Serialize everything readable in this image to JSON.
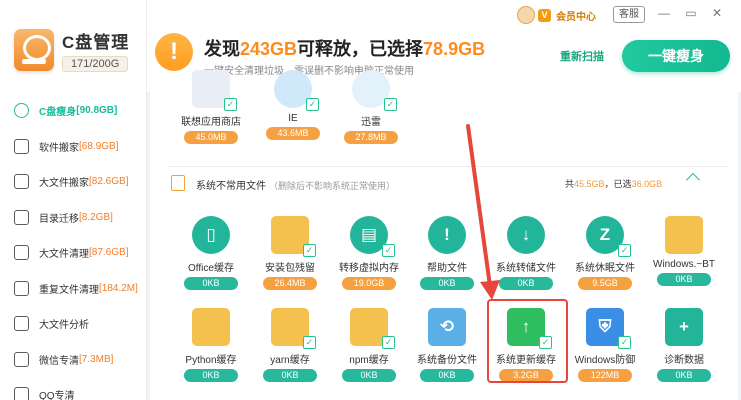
{
  "app": {
    "title": "C盘管理",
    "capacity": "171/200G"
  },
  "sidebar": {
    "items": [
      {
        "label": "C盘瘦身",
        "num": "[90.8GB]",
        "icon": "disk-slim-icon",
        "active": true
      },
      {
        "label": "软件搬家",
        "num": "[68.9GB]",
        "icon": "software-move-icon"
      },
      {
        "label": "大文件搬家",
        "num": "[82.6GB]",
        "icon": "bigfile-move-icon"
      },
      {
        "label": "目录迁移",
        "num": "[8.2GB]",
        "icon": "folder-migrate-icon"
      },
      {
        "label": "大文件清理",
        "num": "[87.6GB]",
        "icon": "bigfile-clean-icon"
      },
      {
        "label": "重复文件清理",
        "num": "[184.2M]",
        "icon": "duplicate-file-icon"
      },
      {
        "label": "大文件分析",
        "num": "",
        "icon": "file-analysis-icon"
      },
      {
        "label": "微信专清",
        "num": "[7.3MB]",
        "icon": "wechat-icon"
      },
      {
        "label": "QQ专清",
        "num": "",
        "icon": "qq-icon"
      }
    ]
  },
  "header": {
    "headline_pre": "发现",
    "headline_total": "243GB",
    "headline_mid": "可释放，已选择",
    "headline_selected": "78.9GB",
    "subline": "一键安全清理垃圾，零误删不影响电脑正常使用",
    "vip_label": "会员中心",
    "service_label": "客服",
    "minimize": "—",
    "maximize": "▭",
    "close": "✕",
    "rescan_label": "重新扫描",
    "slim_button_label": "一键瘦身"
  },
  "top_items": [
    {
      "name": "联想应用商店",
      "size": "45.0MB",
      "icon": "lenovo-store-icon"
    },
    {
      "name": "IE",
      "size": "43.6MB",
      "icon": "ie-icon"
    },
    {
      "name": "迅雷",
      "size": "27.8MB",
      "icon": "xunlei-icon"
    }
  ],
  "section": {
    "title": "系统不常用文件",
    "subtitle": "（删除后不影响系统正常使用）",
    "total_label": "共",
    "total": "45.5GB",
    "selected_label": "，已选",
    "selected": "36.0GB"
  },
  "row1": [
    {
      "name": "Office缓存",
      "size": "0KB",
      "icon": "office-icon"
    },
    {
      "name": "安装包残留",
      "size": "26.4MB",
      "icon": "package-icon"
    },
    {
      "name": "转移虚拟内存",
      "size": "19.0GB",
      "icon": "virtual-memory-icon"
    },
    {
      "name": "帮助文件",
      "size": "0KB",
      "icon": "help-file-icon"
    },
    {
      "name": "系统转储文件",
      "size": "0KB",
      "icon": "dump-file-icon"
    },
    {
      "name": "系统休眠文件",
      "size": "9.5GB",
      "icon": "hibernate-file-icon"
    },
    {
      "name": "Windows.~BT",
      "size": "0KB",
      "icon": "windows-bt-icon"
    }
  ],
  "row2": [
    {
      "name": "Python缓存",
      "size": "0KB",
      "icon": "python-cache-icon"
    },
    {
      "name": "yarn缓存",
      "size": "0KB",
      "icon": "yarn-cache-icon"
    },
    {
      "name": "npm缓存",
      "size": "0KB",
      "icon": "npm-cache-icon"
    },
    {
      "name": "系统备份文件",
      "size": "0KB",
      "icon": "system-backup-icon"
    },
    {
      "name": "系统更新缓存",
      "size": "3.2GB",
      "icon": "system-update-icon"
    },
    {
      "name": "Windows防御",
      "size": "122MB",
      "icon": "windows-defender-icon"
    },
    {
      "name": "诊断数据",
      "size": "0KB",
      "icon": "diagnostic-data-icon"
    }
  ],
  "colors": {
    "accent": "#1abc9c",
    "orange": "#f5a142",
    "highlight_red": "#e6463b"
  }
}
